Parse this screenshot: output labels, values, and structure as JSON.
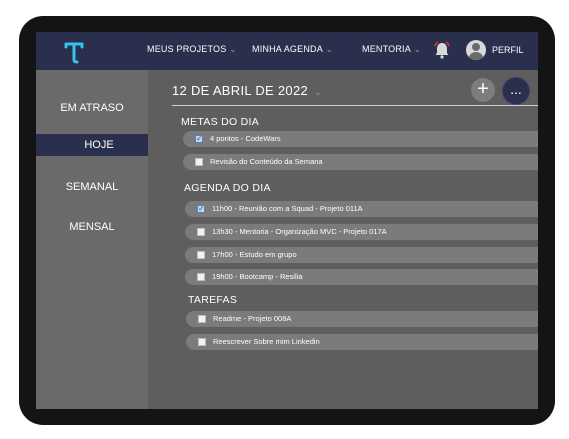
{
  "nav": {
    "items": [
      {
        "label": "MEUS PROJETOS",
        "chevron": "⌄"
      },
      {
        "label": "MINHA AGENDA",
        "chevron": "⌄"
      },
      {
        "label": "MENTORIA",
        "chevron": "⌄"
      }
    ],
    "profile_label": "PERFIL",
    "icons": {
      "logo": "brand-logo",
      "bell": "bell-icon",
      "avatar": "avatar"
    }
  },
  "sidebar": {
    "items": [
      {
        "label": "EM ATRASO",
        "active": false
      },
      {
        "label": "HOJE",
        "active": true
      },
      {
        "label": "SEMANAL",
        "active": false
      },
      {
        "label": "MENSAL",
        "active": false
      }
    ]
  },
  "main": {
    "date": "12 DE ABRIL DE 2022",
    "date_chevron": "⌄",
    "add_button": "+",
    "more_button": "...",
    "sections": [
      {
        "title": "METAS DO DIA",
        "tasks": [
          {
            "label": "4 pontos - CodeWars",
            "checked": true
          },
          {
            "label": "Revisão do Conteúdo da Semana",
            "checked": false
          }
        ]
      },
      {
        "title": "AGENDA DO DIA",
        "tasks": [
          {
            "label": "11h00 - Reunião com a Squad - Projeto 011A",
            "checked": true
          },
          {
            "label": "13h30 - Mentoria - Organização MVC - Projeto 017A",
            "checked": false
          },
          {
            "label": "17h00 - Estudo em grupo",
            "checked": false
          },
          {
            "label": "19h00 - Bootcamp - Resilia",
            "checked": false
          }
        ]
      },
      {
        "title": "TAREFAS",
        "tasks": [
          {
            "label": "Readme - Projeto 008A",
            "checked": false
          },
          {
            "label": "Reescrever Sobre mim Linkedin",
            "checked": false
          }
        ]
      }
    ]
  },
  "colors": {
    "navbar": "#2a2f4d",
    "sidebar": "#6a6a6a",
    "content": "#5e5e5e",
    "task_bar": "#7b7b7b",
    "bell_accent": "#e53935"
  }
}
